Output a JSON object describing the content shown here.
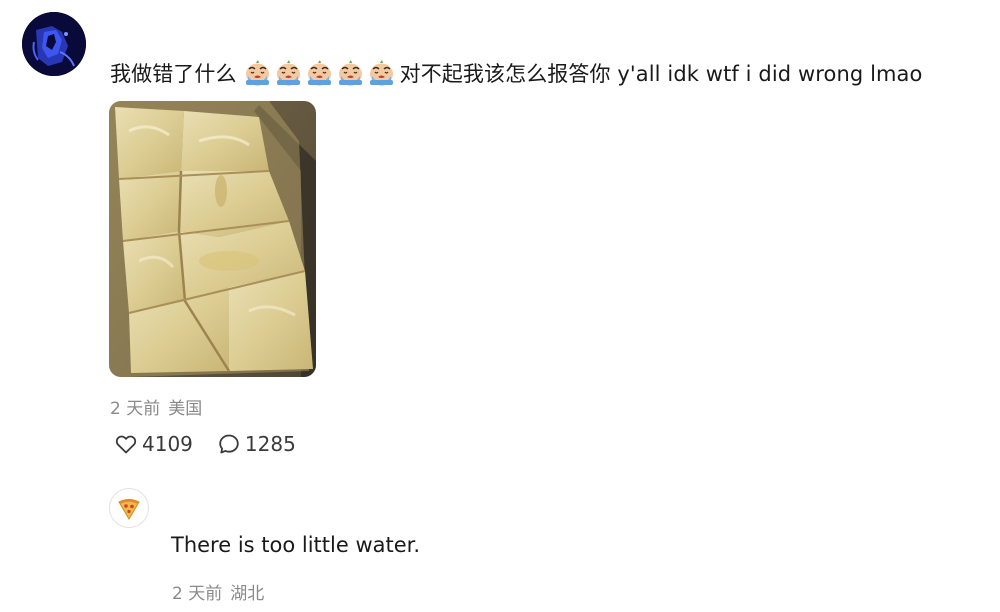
{
  "post": {
    "author_avatar": "blue-portrait-avatar",
    "text_before_emoji": "我做错了什么",
    "emoji": [
      "crying-face-emoji",
      "crying-face-emoji",
      "crying-face-emoji",
      "crying-face-emoji",
      "crying-face-emoji"
    ],
    "text_after_emoji": "对不起我该怎么报答你 y'all idk wtf i did wrong lmao",
    "image_description_icon": "tofu-block-photo",
    "time": "2 天前",
    "location": "美国",
    "like_count": "4109",
    "comment_count": "1285"
  },
  "reply": {
    "avatar_icon": "pizza-slice-icon",
    "text": "There is too little water.",
    "time": "2 天前",
    "location": "湖北"
  },
  "colors": {
    "meta_text": "#8a8a8a",
    "primary_text": "#1a1a1a",
    "avatar_bg": "#0a0a3a"
  }
}
